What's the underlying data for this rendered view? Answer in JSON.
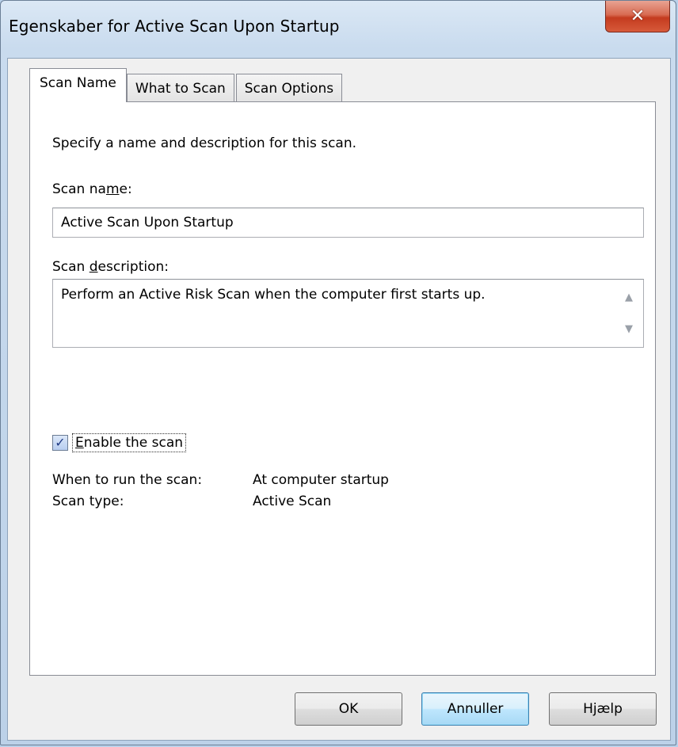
{
  "window": {
    "title": "Egenskaber for Active Scan Upon Startup",
    "close_glyph": "✕"
  },
  "tabs": [
    {
      "label": "Scan Name",
      "active": true
    },
    {
      "label": "What to Scan",
      "active": false
    },
    {
      "label": "Scan Options",
      "active": false
    }
  ],
  "panel": {
    "intro": "Specify a name and description for this scan.",
    "scan_name_label_pre": "Scan na",
    "scan_name_label_u": "m",
    "scan_name_label_post": "e:",
    "scan_name_value": "Active Scan Upon Startup",
    "scan_desc_label_pre": "Scan ",
    "scan_desc_label_u": "d",
    "scan_desc_label_post": "escription:",
    "scan_desc_value": "Perform an Active Risk Scan when the computer first starts up.",
    "enable_checked": true,
    "enable_label_u": "E",
    "enable_label_post": "nable the scan",
    "when_key": "When to run the scan:",
    "when_value": "At computer startup",
    "type_key": "Scan type:",
    "type_value": "Active Scan"
  },
  "buttons": {
    "ok": "OK",
    "cancel": "Annuller",
    "help": "Hjælp"
  },
  "colors": {
    "titlebar": "#c9dbee",
    "close_button": "#c43b1f",
    "default_button_border": "#3c7fb1"
  }
}
